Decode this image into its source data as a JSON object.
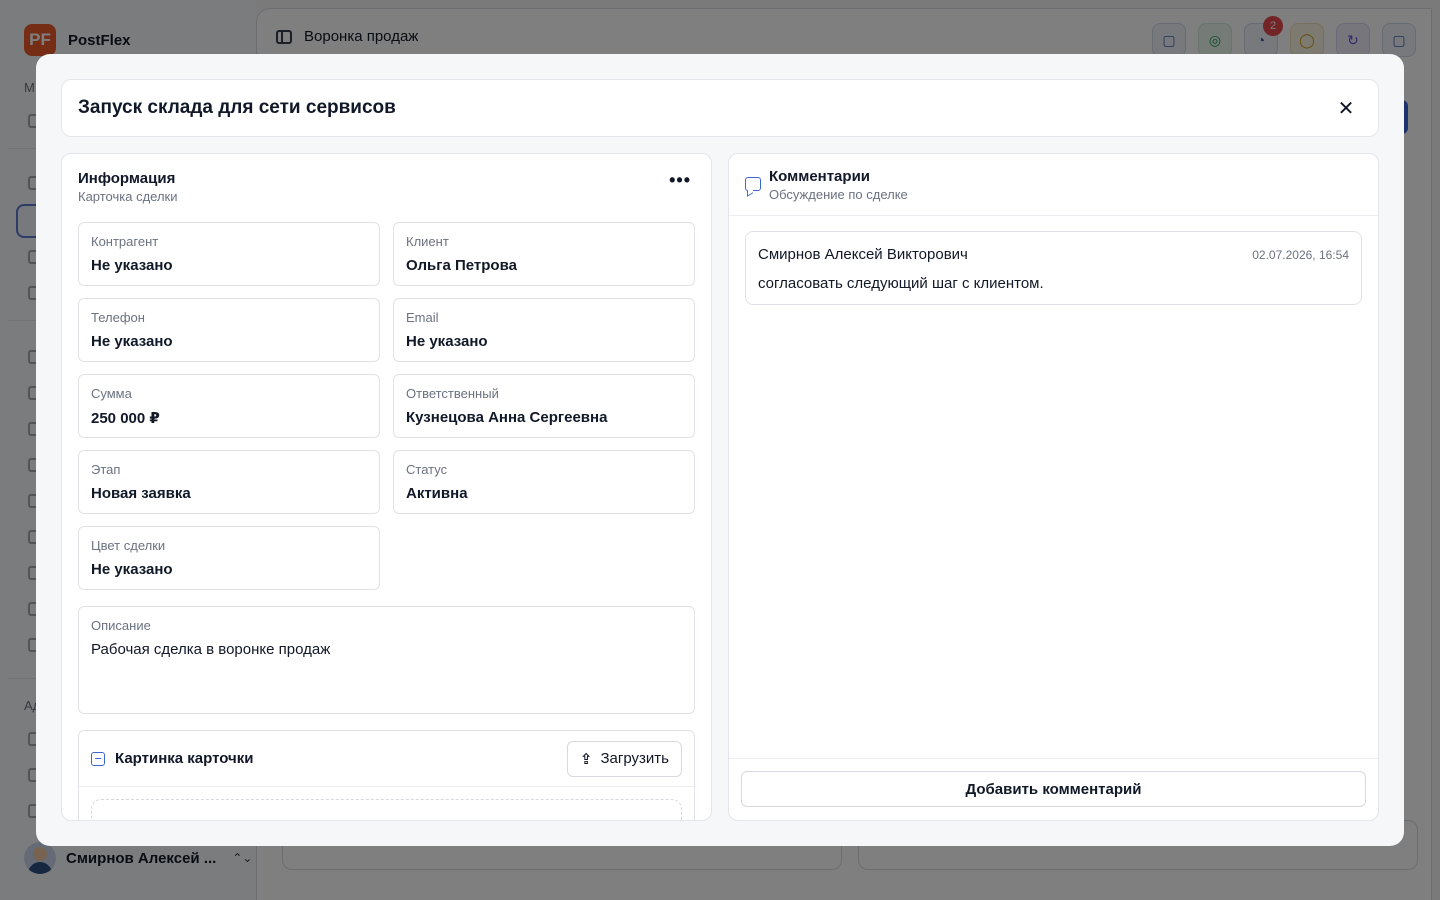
{
  "app": {
    "logo_text": "PF",
    "name": "PostFlex"
  },
  "sidebar": {
    "section_main_label": "М",
    "section_admin_label": "Ад",
    "user_name": "Смирнов Алексей ...",
    "user_chevron": "⌃⌄"
  },
  "header": {
    "page_title": "Воронка продаж",
    "notifications_count": "2"
  },
  "modal": {
    "title": "Запуск склада для сети сервисов",
    "close_glyph": "✕"
  },
  "info": {
    "title": "Информация",
    "subtitle": "Карточка сделки",
    "more_glyph": "•••",
    "fields": [
      {
        "label": "Контрагент",
        "value": "Не указано"
      },
      {
        "label": "Клиент",
        "value": "Ольга Петрова"
      },
      {
        "label": "Телефон",
        "value": "Не указано"
      },
      {
        "label": "Email",
        "value": "Не указано"
      },
      {
        "label": "Сумма",
        "value": "250 000 ₽"
      },
      {
        "label": "Ответственный",
        "value": "Кузнецова Анна Сергеевна"
      },
      {
        "label": "Этап",
        "value": "Новая заявка"
      },
      {
        "label": "Статус",
        "value": "Активна"
      },
      {
        "label": "Цвет сделки",
        "value": "Не указано"
      }
    ],
    "description": {
      "label": "Описание",
      "value": "Рабочая сделка в воронке продаж"
    },
    "image_card": {
      "title": "Картинка карточки",
      "upload_label": "Загрузить"
    }
  },
  "comments": {
    "title": "Комментарии",
    "subtitle": "Обсуждение по сделке",
    "items": [
      {
        "author": "Смирнов Алексей Викторович",
        "date": "02.07.2026, 16:54",
        "text": "согласовать следующий шаг с клиентом."
      }
    ],
    "add_label": "Добавить комментарий"
  },
  "colors": {
    "accent": "#3b66d6",
    "brand": "#ea5b2a",
    "badge": "#e5484d"
  }
}
